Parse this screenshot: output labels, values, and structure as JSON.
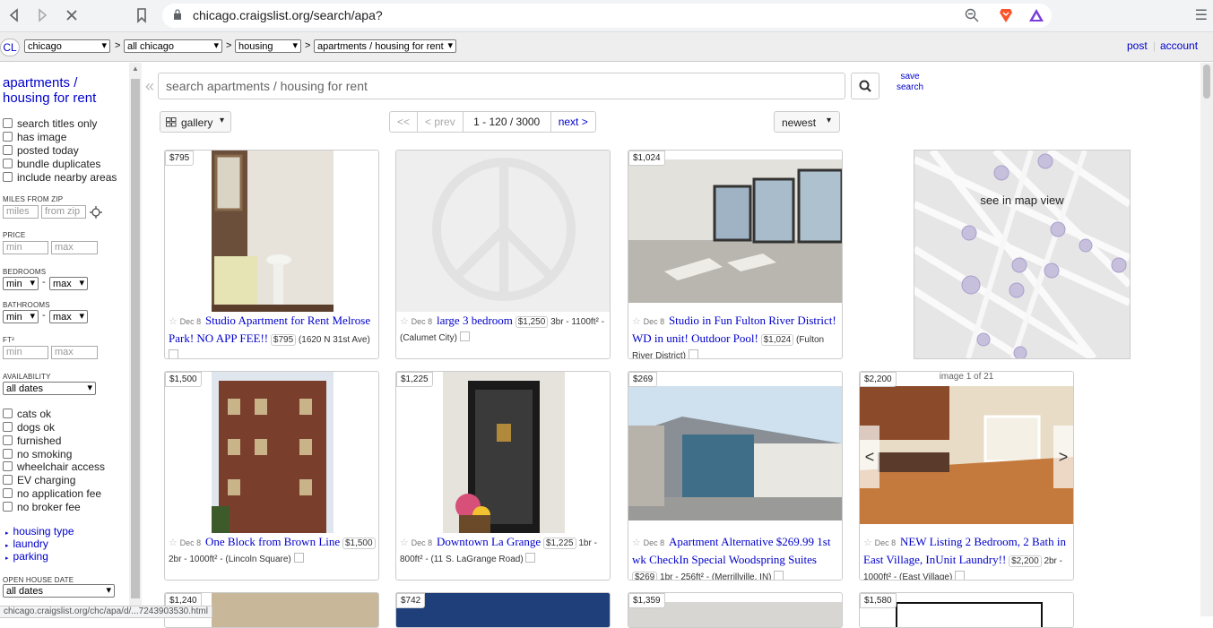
{
  "browser": {
    "url": "chicago.craigslist.org/search/apa?",
    "status_url": "chicago.craigslist.org/chc/apa/d/...7243903530.html"
  },
  "header": {
    "logo": "CL",
    "city": "chicago",
    "area": "all chicago",
    "category": "housing",
    "subcategory": "apartments / housing for rent",
    "sep": ">",
    "post": "post",
    "account": "account"
  },
  "sidebar": {
    "title": "apartments / housing for rent",
    "checks_top": [
      "search titles only",
      "has image",
      "posted today",
      "bundle duplicates",
      "include nearby areas"
    ],
    "miles_label": "MILES FROM ZIP",
    "miles_ph": "miles",
    "zip_ph": "from zip",
    "price_label": "PRICE",
    "min_ph": "min",
    "max_ph": "max",
    "bedrooms_label": "BEDROOMS",
    "bathrooms_label": "BATHROOMS",
    "sel_min": "min",
    "sel_max": "max",
    "dash": "-",
    "ft_label": "FT²",
    "availability_label": "AVAILABILITY",
    "availability": "all dates",
    "checks_bottom": [
      "cats ok",
      "dogs ok",
      "furnished",
      "no smoking",
      "wheelchair access",
      "EV charging",
      "no application fee",
      "no broker fee"
    ],
    "links": [
      "housing type",
      "laundry",
      "parking"
    ],
    "open_house_label": "OPEN HOUSE DATE",
    "open_house": "all dates"
  },
  "search": {
    "placeholder": "search apartments / housing for rent",
    "save_line1": "save",
    "save_line2": "search"
  },
  "toolbar": {
    "view": "gallery",
    "first": "<<",
    "prev": "< prev",
    "range": "1 - 120 / 3000",
    "next": "next >",
    "sort": "newest"
  },
  "map": {
    "label": "see in map view"
  },
  "listings": [
    {
      "price": "$795",
      "date": "Dec 8",
      "title": "Studio Apartment for Rent Melrose Park! NO APP FEE!!",
      "badge": "$795",
      "details": "(1620 N 31st Ave)"
    },
    {
      "price": "",
      "date": "Dec 8",
      "title": "large 3 bedroom",
      "badge": "$1,250",
      "details": "3br - 1100ft² - (Calumet City)"
    },
    {
      "price": "$1,024",
      "date": "Dec 8",
      "title": "Studio in Fun Fulton River District! WD in unit! Outdoor Pool!",
      "badge": "$1,024",
      "details": "(Fulton River District)"
    },
    {
      "price": "$1,500",
      "date": "Dec 8",
      "title": "One Block from Brown Line",
      "badge": "$1,500",
      "details": "2br - 1000ft² - (Lincoln Square)"
    },
    {
      "price": "$1,225",
      "date": "Dec 8",
      "title": "Downtown La Grange",
      "badge": "$1,225",
      "details": "1br - 800ft² - (11 S. LaGrange Road)"
    },
    {
      "price": "$269",
      "date": "Dec 8",
      "title": "Apartment Alternative $269.99 1st wk CheckIn Special Woodspring Suites",
      "badge": "$269",
      "details": "1br - 256ft² - (Merrillville, IN)"
    },
    {
      "price": "$2,200",
      "date": "Dec 8",
      "title": "NEW Listing 2 Bedroom, 2 Bath in East Village, InUnit Laundry!!",
      "badge": "$2,200",
      "details": "2br - 1000ft² - (East Village)",
      "image_counter": "image 1 of 21"
    },
    {
      "price": "$1,240"
    },
    {
      "price": "$742"
    },
    {
      "price": "$1,359"
    },
    {
      "price": "$1,580"
    }
  ]
}
